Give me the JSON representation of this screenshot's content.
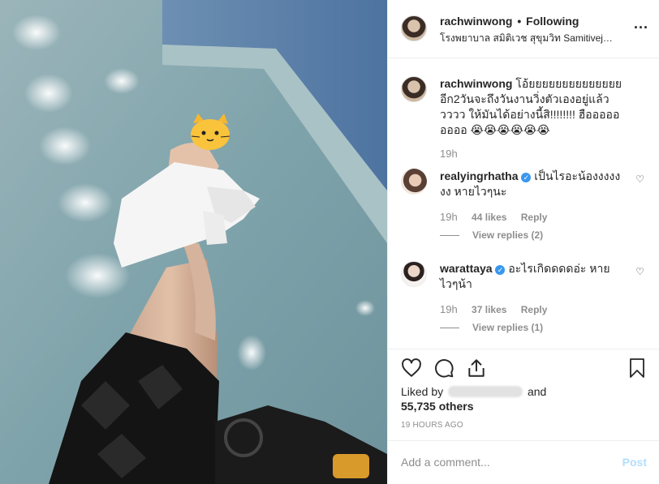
{
  "post": {
    "owner": "rachwinwong",
    "separator": "•",
    "follow_status": "Following",
    "location": "โรงพยาบาล สมิติเวช สุขุมวิท Samitivej Sukhu...",
    "more_icon": "ellipsis-icon"
  },
  "caption": {
    "username": "rachwinwong",
    "text": "โอ้ยยยยยยยยยยยยยย อีก2วันจะถึงวันงานวิ่งตัวเองอยู่แล้ววววว ให้มันได้อย่างนี้สิ!!!!!!!! ฮือออออออออ 😭😭😭😭😭😭",
    "time": "19h"
  },
  "comments": [
    {
      "username": "realyingrhatha",
      "verified": true,
      "text": "เป็นไรอะน้องงงงงงง หายไวๆนะ",
      "time": "19h",
      "likes": "44 likes",
      "reply_label": "Reply",
      "view_replies": "View replies (2)"
    },
    {
      "username": "warattaya",
      "verified": true,
      "text": "อะไรเกิดดดดอ่ะ หายไวๆน้า",
      "time": "19h",
      "likes": "37 likes",
      "reply_label": "Reply",
      "view_replies": "View replies (1)"
    }
  ],
  "actions": {
    "like_icon": "heart-icon",
    "comment_icon": "comment-icon",
    "share_icon": "share-icon",
    "save_icon": "bookmark-icon"
  },
  "likes": {
    "prefix": "Liked by",
    "and": "and",
    "others": "55,735 others"
  },
  "timestamp": "19 HOURS AGO",
  "add_comment": {
    "placeholder": "Add a comment...",
    "post_label": "Post"
  },
  "colors": {
    "link_blue": "#3897f0",
    "post_disabled": "#b2dffc",
    "secondary_text": "#8e8e8e"
  }
}
